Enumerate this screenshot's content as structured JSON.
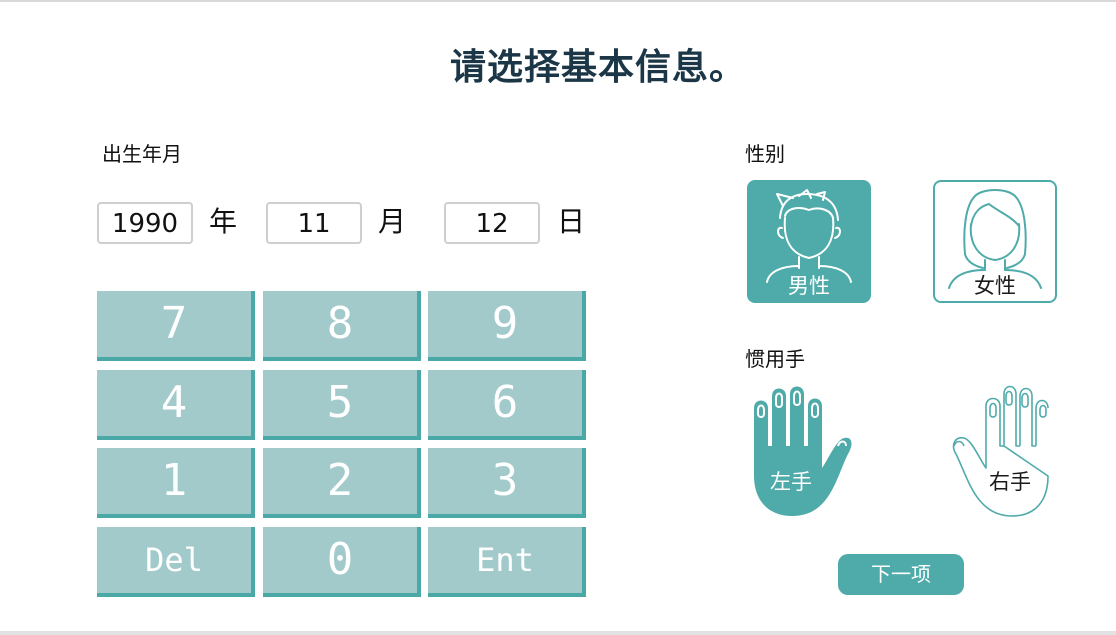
{
  "page": {
    "title": "请选择基本信息。"
  },
  "birth": {
    "label": "出生年月",
    "year_value": "1990",
    "year_unit": "年",
    "month_value": "11",
    "month_unit": "月",
    "day_value": "12",
    "day_unit": "日"
  },
  "keypad": {
    "keys": [
      "7",
      "8",
      "9",
      "4",
      "5",
      "6",
      "1",
      "2",
      "3",
      "Del",
      "0",
      "Ent"
    ]
  },
  "gender": {
    "label": "性别",
    "options": [
      {
        "label": "男性",
        "icon": "male-avatar-icon",
        "selected": true
      },
      {
        "label": "女性",
        "icon": "female-avatar-icon",
        "selected": false
      }
    ]
  },
  "handedness": {
    "label": "惯用手",
    "options": [
      {
        "label": "左手",
        "icon": "left-hand-icon",
        "selected": true
      },
      {
        "label": "右手",
        "icon": "right-hand-icon",
        "selected": false
      }
    ]
  },
  "actions": {
    "next_label": "下一项"
  },
  "colors": {
    "accent": "#4fabaa",
    "key_face": "#a2cacb",
    "key_shadow": "#4aa8a7",
    "title": "#1b3646"
  }
}
